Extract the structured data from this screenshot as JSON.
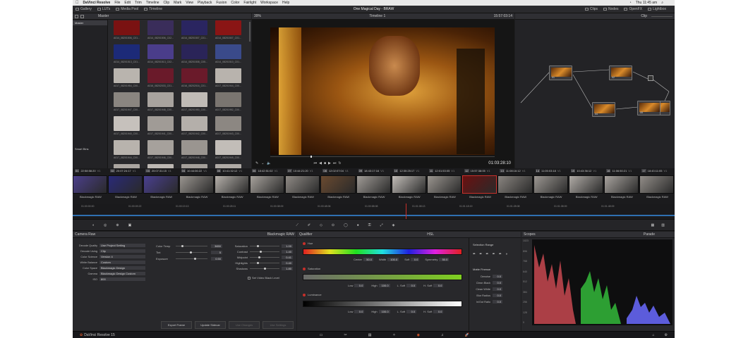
{
  "macos": {
    "apple": "",
    "app_name": "DaVinci Resolve",
    "menus": [
      "File",
      "Edit",
      "Trim",
      "Timeline",
      "Clip",
      "Mark",
      "View",
      "Playback",
      "Fusion",
      "Color",
      "Fairlight",
      "Workspace",
      "Help"
    ],
    "clock": "Thu 11:45 am"
  },
  "topbar": {
    "left_buttons": [
      "Gallery",
      "LUTs",
      "Media Pool",
      "Timeline"
    ],
    "project_title": "One Magical Day - BRAW",
    "right_buttons": [
      "Clips",
      "Nodes",
      "OpenFX",
      "Lightbox"
    ]
  },
  "gallery": {
    "header": "Master",
    "tree_master": "Master",
    "tree_smart": "Smart Bins",
    "thumbs": [
      {
        "label": "A014_08201506_C01...",
        "color": "#7a1212"
      },
      {
        "label": "A014_08201506_C02...",
        "color": "#3a2d5a"
      },
      {
        "label": "A014_08201507_C01...",
        "color": "#2a2560"
      },
      {
        "label": "A014_08201507_C01...",
        "color": "#8a1515"
      },
      {
        "label": "A014_08201513_C01...",
        "color": "#1c2a78"
      },
      {
        "label": "A014_08201513_C02...",
        "color": "#4a3d8a"
      },
      {
        "label": "A014_08201508_C05...",
        "color": "#2a2458"
      },
      {
        "label": "A014_08201510_C01...",
        "color": "#3a4a8a"
      },
      {
        "label": "A017_08201954_C00...",
        "color": "#b9b4ae"
      },
      {
        "label": "A016_08202033_C01...",
        "color": "#6a1a2a"
      },
      {
        "label": "A016_08202016_C01...",
        "color": "#6a1a2a"
      },
      {
        "label": "A017_08201944_C00...",
        "color": "#b8b3ad"
      },
      {
        "label": "A017_08201947_C00...",
        "color": "#8a8580"
      },
      {
        "label": "A017_08201948_C00...",
        "color": "#a8a39e"
      },
      {
        "label": "A017_08201950_C00...",
        "color": "#c0bbb6"
      },
      {
        "label": "A017_08201952_C00...",
        "color": "#7a7570"
      },
      {
        "label": "A017_08201940_C00...",
        "color": "#c6c1bc"
      },
      {
        "label": "A017_08201941_C00...",
        "color": "#a09b96"
      },
      {
        "label": "A017_08201942_C00...",
        "color": "#b4afaa"
      },
      {
        "label": "A017_08201943_C00...",
        "color": "#8c8782"
      },
      {
        "label": "A017_08201944_C00...",
        "color": "#b8b3ad"
      },
      {
        "label": "A017_08201946_C00...",
        "color": "#a6a19c"
      },
      {
        "label": "A017_08201948_C00...",
        "color": "#9a9590"
      },
      {
        "label": "A017_08201949_C00...",
        "color": "#c2bdb8"
      },
      {
        "label": "A017_08201950_C00...",
        "color": "#aaa5a0"
      },
      {
        "label": "A017_08201952_C00...",
        "color": "#bcb7b2"
      },
      {
        "label": "A017_08201953_C00...",
        "color": "#a49f9a"
      },
      {
        "label": "A017_08201954_C00...",
        "color": "#b0aba6"
      }
    ]
  },
  "viewer": {
    "zoom": "39%",
    "timeline_name": "Timeline 1",
    "timecode_top": "15:57:03:14",
    "timecode": "01:03:28:10",
    "clip_label": "Clip"
  },
  "nodes": [
    {
      "label": "01"
    },
    {
      "label": "02"
    },
    {
      "label": "03"
    },
    {
      "label": "04"
    },
    {
      "label": "05"
    }
  ],
  "timeline": {
    "clips": [
      {
        "num": "01",
        "tc": "22:58:58:20",
        "track": "V1",
        "name": "Blackmagic RAW",
        "color": "#4b3f8a"
      },
      {
        "num": "02",
        "tc": "20:07:24:17",
        "track": "V1",
        "name": "Blackmagic RAW",
        "color": "#2a2a78"
      },
      {
        "num": "03",
        "tc": "20:07:31:15",
        "track": "V1",
        "name": "Blackmagic RAW",
        "color": "#4a4090"
      },
      {
        "num": "04",
        "tc": "10:44:06:22",
        "track": "V1",
        "name": "Blackmagic RAW",
        "color": "#9a9590"
      },
      {
        "num": "05",
        "tc": "10:41:32:12",
        "track": "V1",
        "name": "Blackmagic RAW",
        "color": "#b5b0aa"
      },
      {
        "num": "06",
        "tc": "18:42:51:02",
        "track": "V1",
        "name": "Blackmagic RAW",
        "color": "#a7a29c"
      },
      {
        "num": "07",
        "tc": "10:44:21:20",
        "track": "V1",
        "name": "Blackmagic RAW",
        "color": "#8f8a85"
      },
      {
        "num": "08",
        "tc": "12:02:07:04",
        "track": "V1",
        "name": "Blackmagic RAW",
        "color": "#6a4a30"
      },
      {
        "num": "09",
        "tc": "18:43:17:16",
        "track": "V1",
        "name": "Blackmagic RAW",
        "color": "#a09b96"
      },
      {
        "num": "10",
        "tc": "12:30:25:17",
        "track": "V1",
        "name": "Blackmagic RAW",
        "color": "#c2bdb8"
      },
      {
        "num": "11",
        "tc": "12:01:53:05",
        "track": "V1",
        "name": "Blackmagic RAW",
        "color": "#9a958f"
      },
      {
        "num": "12",
        "tc": "15:57:38:05",
        "track": "V1",
        "name": "Blackmagic RAW",
        "color": "#6a1010"
      },
      {
        "num": "13",
        "tc": "11:08:16:12",
        "track": "V1",
        "name": "Blackmagic RAW",
        "color": "#8a8580"
      },
      {
        "num": "14",
        "tc": "11:05:03:18",
        "track": "V1",
        "name": "Blackmagic RAW",
        "color": "#9c9792"
      },
      {
        "num": "15",
        "tc": "10:43:36:12",
        "track": "V1",
        "name": "Blackmagic RAW",
        "color": "#b0aba6"
      },
      {
        "num": "16",
        "tc": "11:06:50:21",
        "track": "V1",
        "name": "Blackmagic RAW",
        "color": "#a8a39e"
      },
      {
        "num": "17",
        "tc": "18:43:11:05",
        "track": "V1",
        "name": "Blackmagic RAW",
        "color": "#928d88"
      }
    ],
    "ruler": [
      "01:00:00:00",
      "01:00:09:22",
      "01:00:19:13",
      "01:00:28:11",
      "01:00:38:09",
      "01:00:48:06",
      "01:00:58:08",
      "01:01:08:13",
      "01:01:18:19",
      "01:01:28:08",
      "01:01:38:09",
      "01:01:48:09"
    ]
  },
  "camera_raw": {
    "title": "Camera Raw",
    "codec": "Blackmagic RAW",
    "rows": [
      {
        "label": "Decode Quality",
        "value": "Use Project Setting"
      },
      {
        "label": "Decode Using",
        "value": "Clip"
      },
      {
        "label": "Color Science",
        "value": "Version 4"
      },
      {
        "label": "White Balance",
        "value": "Custom"
      },
      {
        "label": "Color Space",
        "value": "Blackmagic Design"
      },
      {
        "label": "Gamma",
        "value": "Blackmagic Design Custom"
      },
      {
        "label": "ISO",
        "value": "800"
      }
    ],
    "mid": [
      {
        "label": "Color Temp",
        "value": "3650"
      },
      {
        "label": "Tint",
        "value": "5"
      },
      {
        "label": "Exposure",
        "value": "0.50"
      }
    ],
    "right": [
      {
        "label": "Saturation",
        "value": "1.00"
      },
      {
        "label": "Contrast",
        "value": "1.40"
      },
      {
        "label": "Midpoint",
        "value": "0.41"
      },
      {
        "label": "Highlights",
        "value": "0.40"
      },
      {
        "label": "Shadows",
        "value": "1.80"
      }
    ],
    "checkbox_label": "Set Video Black Level",
    "buttons": [
      "Export Frame",
      "Update Sidecar",
      "Use Changes",
      "Use Settings"
    ]
  },
  "qualifier": {
    "title": "Qualifier",
    "mode": "HSL",
    "hue": {
      "label": "Hue",
      "center_label": "Center",
      "center": "50.0",
      "width_label": "Width",
      "width": "100.0",
      "soft_label": "Soft",
      "soft": "0.0",
      "sym_label": "Symmetry",
      "sym": "50.0"
    },
    "sat": {
      "label": "Saturation",
      "low_label": "Low",
      "low": "0.0",
      "high_label": "High",
      "high": "100.0",
      "lsoft_label": "L. Soft",
      "lsoft": "0.0",
      "hsoft_label": "H. Soft",
      "hsoft": "0.0"
    },
    "lum": {
      "label": "Luminance",
      "low_label": "Low",
      "low": "0.0",
      "high_label": "High",
      "high": "100.0",
      "lsoft_label": "L. Soft",
      "lsoft": "0.0",
      "hsoft_label": "H. Soft",
      "hsoft": "0.0"
    },
    "selection_range": "Selection Range",
    "matte_finesse": "Matte Finesse",
    "matte_rows": [
      {
        "label": "Denoise",
        "value": "0.0"
      },
      {
        "label": "Clean Black",
        "value": "0.0"
      },
      {
        "label": "Clean White",
        "value": "0.0"
      },
      {
        "label": "Blur Radius",
        "value": "0.0"
      },
      {
        "label": "In/Out Ratio",
        "value": "0.0"
      }
    ]
  },
  "scopes": {
    "title": "Scopes",
    "mode": "Parade",
    "ticks": [
      "1023",
      "896",
      "768",
      "640",
      "512",
      "384",
      "256",
      "128",
      "0"
    ]
  },
  "footer": {
    "app": "DaVinci Resolve 15"
  },
  "colors": {
    "accent_red": "#c8302a",
    "panel_bg": "#28282b",
    "ui_bg": "#1e1e20"
  }
}
